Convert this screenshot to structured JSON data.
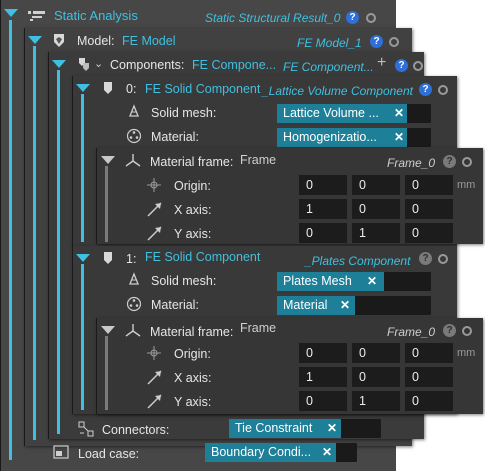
{
  "root": {
    "title": "Static Analysis",
    "value": "Static Structural Result_0",
    "help": "?"
  },
  "model": {
    "label": "Model:",
    "name": "FE Model",
    "value": "FE Model_1",
    "help": "?"
  },
  "components": {
    "label": "Components:",
    "name": "FE Compone...",
    "value": "FE Component...",
    "add": "+",
    "help": "?"
  },
  "comp0": {
    "index": "0:",
    "name": "FE Solid Component",
    "value": "_Lattice Volume Component",
    "help": "?",
    "solid_mesh_label": "Solid mesh:",
    "solid_mesh_value": "Lattice Volume ...",
    "material_label": "Material:",
    "material_value": "Homogenizatio...",
    "frame": {
      "label": "Material frame:",
      "name": "Frame",
      "value": "Frame_0",
      "help": "?",
      "origin_label": "Origin:",
      "origin": [
        "0",
        "0",
        "0"
      ],
      "unit": "mm",
      "xaxis_label": "X axis:",
      "xaxis": [
        "1",
        "0",
        "0"
      ],
      "yaxis_label": "Y axis:",
      "yaxis": [
        "0",
        "1",
        "0"
      ]
    }
  },
  "comp1": {
    "index": "1:",
    "name": "FE Solid Component",
    "value": "_Plates Component",
    "help": "?",
    "solid_mesh_label": "Solid mesh:",
    "solid_mesh_value": "Plates Mesh",
    "material_label": "Material:",
    "material_value": "Material",
    "frame": {
      "label": "Material frame:",
      "name": "Frame",
      "value": "Frame_0",
      "help": "?",
      "origin_label": "Origin:",
      "origin": [
        "0",
        "0",
        "0"
      ],
      "unit": "mm",
      "xaxis_label": "X axis:",
      "xaxis": [
        "1",
        "0",
        "0"
      ],
      "yaxis_label": "Y axis:",
      "yaxis": [
        "0",
        "1",
        "0"
      ]
    }
  },
  "connectors": {
    "label": "Connectors:",
    "value": "Tie Constraint"
  },
  "load_case": {
    "label": "Load case:",
    "value": "Boundary Condi..."
  },
  "colors": {
    "accent": "#3fc0e0",
    "chip": "#1e7f98",
    "help": "#2f6fd8"
  }
}
